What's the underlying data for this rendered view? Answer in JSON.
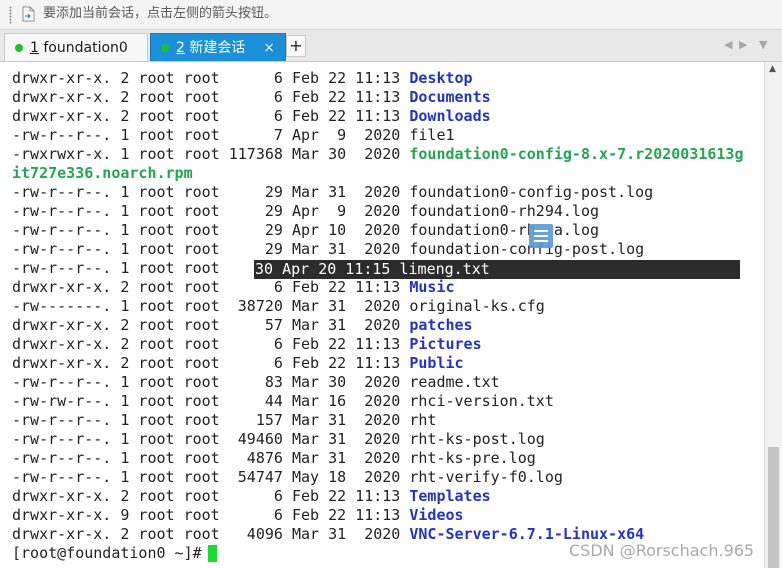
{
  "hint_bar": {
    "text": "要添加当前会话，点击左侧的箭头按钮。",
    "icon": "document-arrow-icon"
  },
  "tabs": [
    {
      "number": "1",
      "label": "foundation0",
      "active": false,
      "status_color": "#19c22f"
    },
    {
      "number": "2",
      "label": "新建会话",
      "active": true,
      "status_color": "#19c22f",
      "close": "×"
    }
  ],
  "tab_add": "+",
  "tab_nav": {
    "prev": "◀",
    "next": "▶",
    "menu": "▼"
  },
  "terminal": {
    "lines": [
      {
        "meta": "drwxr-xr-x. 2 root root      6 Feb 22 11:13 ",
        "name": "Desktop",
        "type": "dir"
      },
      {
        "meta": "drwxr-xr-x. 2 root root      6 Feb 22 11:13 ",
        "name": "Documents",
        "type": "dir"
      },
      {
        "meta": "drwxr-xr-x. 2 root root      6 Feb 22 11:13 ",
        "name": "Downloads",
        "type": "dir"
      },
      {
        "meta": "-rw-r--r--. 1 root root      7 Apr  9  2020 ",
        "name": "file1",
        "type": "file"
      },
      {
        "meta": "-rwxrwxr-x. 1 root root 117368 Mar 30  2020 ",
        "name": "foundation0-config-8.x-7.r2020031613g",
        "type": "exe"
      },
      {
        "meta": "",
        "name": "it727e336.noarch.rpm",
        "type": "exe"
      },
      {
        "meta": "-rw-r--r--. 1 root root     29 Mar 31  2020 ",
        "name": "foundation0-config-post.log",
        "type": "file"
      },
      {
        "meta": "-rw-r--r--. 1 root root     29 Apr  9  2020 ",
        "name": "foundation0-rh294.log",
        "type": "file"
      },
      {
        "meta": "-rw-r--r--. 1 root root     29 Apr 10  2020 ",
        "name": "foundation0-rh  a.log",
        "type": "file"
      },
      {
        "meta": "-rw-r--r--. 1 root root     29 Mar 31  2020 ",
        "name": "foundation-config-post.log",
        "type": "file"
      },
      {
        "meta": "-rw-r--r--. 1 root root  ",
        "name": "",
        "type": "selected"
      },
      {
        "meta": "drwxr-xr-x. 2 root root      6 Feb 22 11:13 ",
        "name": "Music",
        "type": "dir"
      },
      {
        "meta": "-rw-------. 1 root root  38720 Mar 31  2020 ",
        "name": "original-ks.cfg",
        "type": "file"
      },
      {
        "meta": "drwxr-xr-x. 2 root root     57 Mar 31  2020 ",
        "name": "patches",
        "type": "dir"
      },
      {
        "meta": "drwxr-xr-x. 2 root root      6 Feb 22 11:13 ",
        "name": "Pictures",
        "type": "dir"
      },
      {
        "meta": "drwxr-xr-x. 2 root root      6 Feb 22 11:13 ",
        "name": "Public",
        "type": "dir"
      },
      {
        "meta": "-rw-r--r--. 1 root root     83 Mar 30  2020 ",
        "name": "readme.txt",
        "type": "file"
      },
      {
        "meta": "-rw-rw-r--. 1 root root     44 Mar 16  2020 ",
        "name": "rhci-version.txt",
        "type": "file"
      },
      {
        "meta": "-rw-r--r--. 1 root root    157 Mar 31  2020 ",
        "name": "rht",
        "type": "file"
      },
      {
        "meta": "-rw-r--r--. 1 root root  49460 Mar 31  2020 ",
        "name": "rht-ks-post.log",
        "type": "file"
      },
      {
        "meta": "-rw-r--r--. 1 root root   4876 Mar 31  2020 ",
        "name": "rht-ks-pre.log",
        "type": "file"
      },
      {
        "meta": "-rw-r--r--. 1 root root  54747 May 18  2020 ",
        "name": "rht-verify-f0.log",
        "type": "file"
      },
      {
        "meta": "drwxr-xr-x. 2 root root      6 Feb 22 11:13 ",
        "name": "Templates",
        "type": "dir"
      },
      {
        "meta": "drwxr-xr-x. 9 root root      6 Feb 22 11:13 ",
        "name": "Videos",
        "type": "dir"
      },
      {
        "meta": "drwxr-xr-x. 2 root root   4096 Mar 31  2020 ",
        "name": "VNC-Server-6.7.1-Linux-x64",
        "type": "dir"
      }
    ],
    "selected_text": "30 Apr 20 11:15 limeng.txt",
    "prompt": "[root@foundation0 ~]# ",
    "colors": {
      "dir": "#2233cc",
      "exe": "#21a84e",
      "cursor": "#16dc2e",
      "selection": "#2c2c2c"
    }
  },
  "watermark": "CSDN @Rorschach.965"
}
